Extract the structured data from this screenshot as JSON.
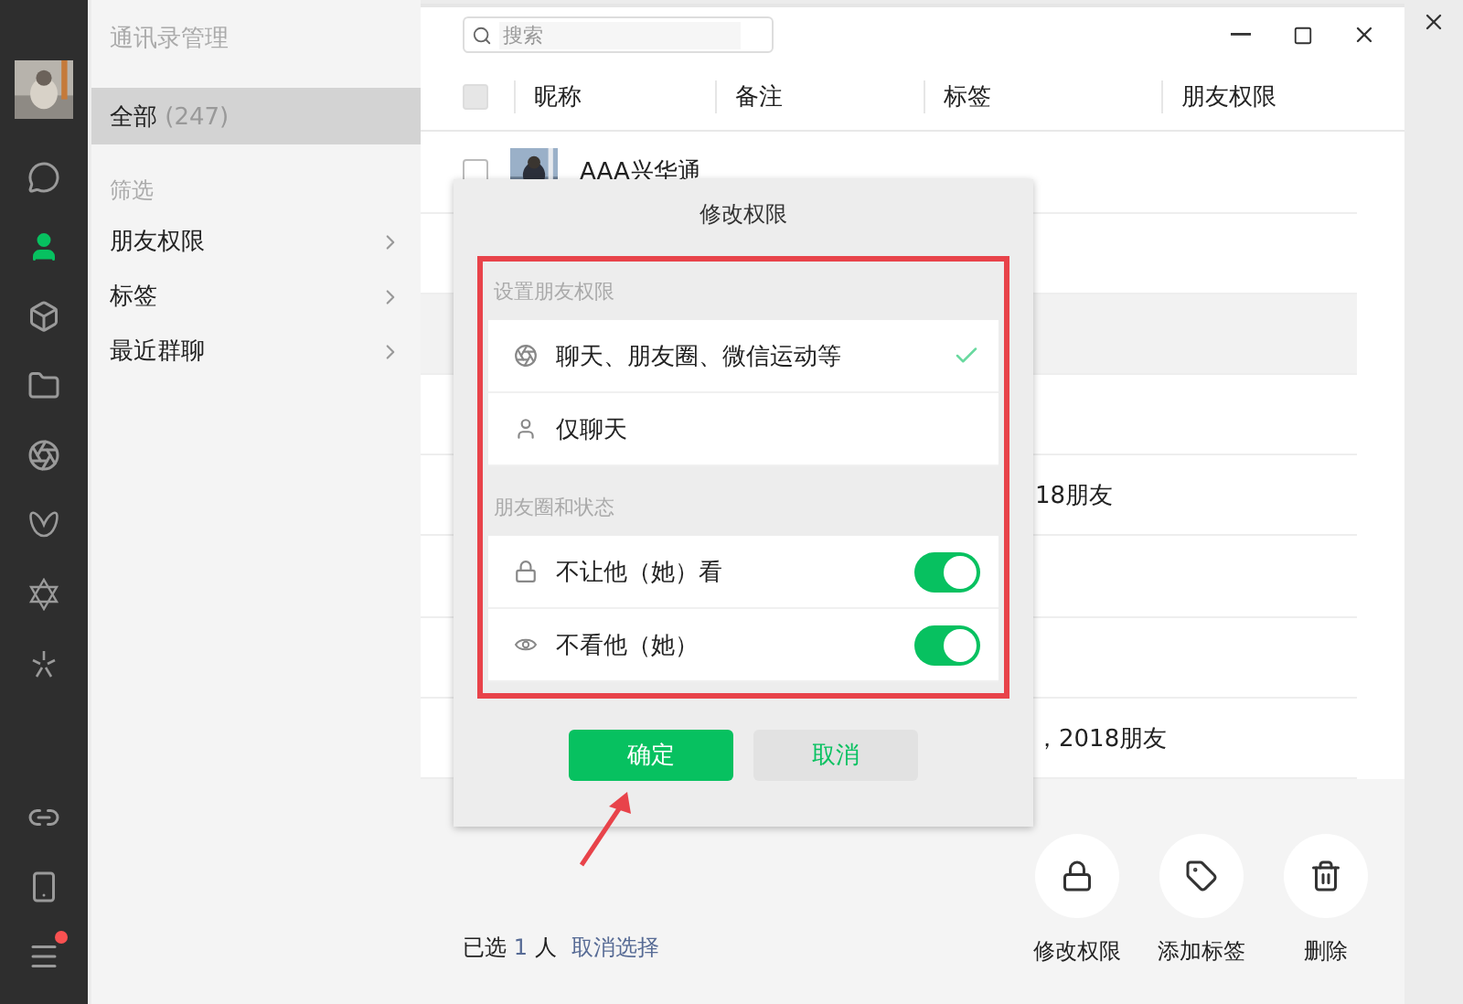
{
  "sidebar": {
    "nav": [
      {
        "kind": "chat",
        "selected": false
      },
      {
        "kind": "contacts",
        "selected": true
      },
      {
        "kind": "box",
        "selected": false
      },
      {
        "kind": "folder",
        "selected": false
      },
      {
        "kind": "aperture",
        "selected": false
      },
      {
        "kind": "butterfly",
        "selected": false
      },
      {
        "kind": "star",
        "selected": false
      },
      {
        "kind": "sparkle",
        "selected": false
      }
    ],
    "bottom": [
      {
        "kind": "link",
        "badge": false
      },
      {
        "kind": "phone",
        "badge": false
      },
      {
        "kind": "menu",
        "badge": true
      }
    ]
  },
  "contacts_panel": {
    "title": "通讯录管理",
    "all": {
      "label": "全部",
      "count": "(247)",
      "selected": true
    },
    "filter_heading": "筛选",
    "filters": [
      {
        "label": "朋友权限"
      },
      {
        "label": "标签"
      },
      {
        "label": "最近群聊"
      }
    ]
  },
  "search": {
    "placeholder": "搜索"
  },
  "table": {
    "select_all": {
      "disabled": true
    },
    "columns": [
      "昵称",
      "备注",
      "标签",
      "朋友权限"
    ],
    "rows": [
      {
        "nickname": "AAA兴华通",
        "checked": false,
        "selected": false
      },
      {
        "selected": false
      },
      {
        "selected": true
      },
      {
        "selected": false
      },
      {
        "tags": "18朋友",
        "selected": false
      },
      {
        "selected": false
      },
      {
        "selected": false
      },
      {
        "tags": "，2018朋友",
        "selected": false
      }
    ]
  },
  "dialog": {
    "title": "修改权限",
    "sections": [
      {
        "heading": "设置朋友权限",
        "options": [
          {
            "kind": "choice",
            "label": "聊天、朋友圈、微信运动等",
            "selected": true
          },
          {
            "kind": "choice",
            "label": "仅聊天",
            "selected": false
          }
        ]
      },
      {
        "heading": "朋友圈和状态",
        "options": [
          {
            "kind": "toggle",
            "label": "不让他（她）看",
            "on": true
          },
          {
            "kind": "toggle",
            "label": "不看他（她）",
            "on": true
          }
        ]
      }
    ],
    "buttons": [
      {
        "kind": "primary",
        "label": "确定"
      },
      {
        "kind": "secondary",
        "label": "取消"
      }
    ]
  },
  "annotations": {
    "highlight_box": true,
    "arrow": true
  },
  "footer": {
    "prefix": "已选",
    "count": "1",
    "suffix": "人",
    "clear_link": "取消选择",
    "actions": [
      {
        "kind": "lock",
        "label": "修改权限"
      },
      {
        "kind": "tag",
        "label": "添加标签"
      },
      {
        "kind": "delete",
        "label": "删除"
      }
    ]
  }
}
